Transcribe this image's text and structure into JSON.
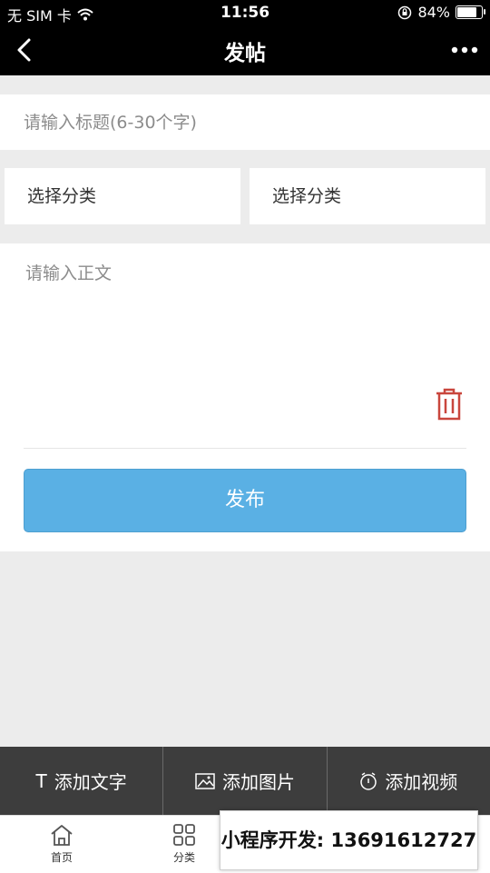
{
  "status_bar": {
    "carrier": "无 SIM 卡",
    "time": "11:56",
    "battery": "84%",
    "battery_level": 0.84
  },
  "nav": {
    "title": "发帖"
  },
  "form": {
    "title_placeholder": "请输入标题(6-30个字)",
    "category_1": "选择分类",
    "category_2": "选择分类",
    "body_placeholder": "请输入正文",
    "publish_label": "发布"
  },
  "toolbar": {
    "add_text": "添加文字",
    "add_image": "添加图片",
    "add_video": "添加视频"
  },
  "tabbar": {
    "home": "首页",
    "category": "分类"
  },
  "ad_banner": "小程序开发: 13691612727",
  "colors": {
    "publish_button": "#5ab0e4",
    "trash_icon": "#c9463d",
    "toolbar_bg": "#3d3d3d"
  },
  "icons": [
    "back-arrow-icon",
    "more-dots-icon",
    "trash-icon",
    "text-icon",
    "image-icon",
    "video-icon",
    "home-icon",
    "grid-icon",
    "wifi-icon",
    "lock-rotation-icon"
  ]
}
